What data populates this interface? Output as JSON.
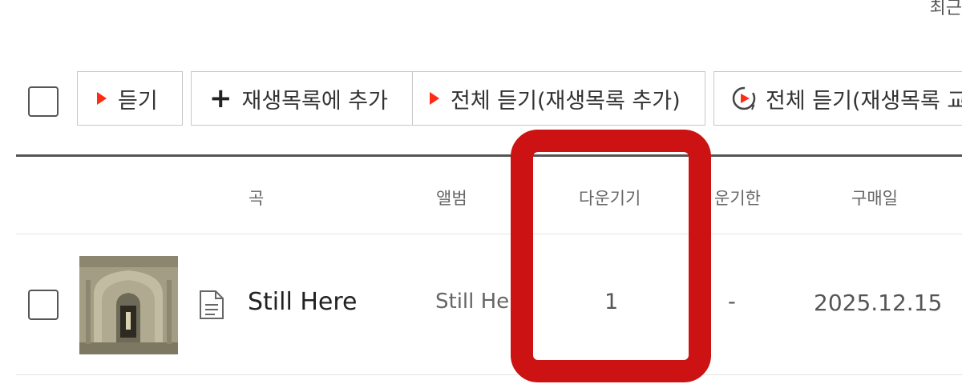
{
  "header": {
    "top_right_text": "최근"
  },
  "toolbar": {
    "listen_label": "듣기",
    "add_playlist_label": "재생목록에 추가",
    "listen_all_add_label": "전체 듣기(재생목록 추가)",
    "listen_all_replace_label": "전체 듣기(재생목록 교체)",
    "accent_color": "#ff2b14"
  },
  "table": {
    "columns": [
      "곡",
      "앨범",
      "다운기기",
      "운기한",
      "구매일"
    ],
    "rows": [
      {
        "song": "Still Here",
        "album": "Still Here",
        "download_devices": "1",
        "expiry": "-",
        "purchase_date": "2025.12.15"
      }
    ]
  },
  "annotation": {
    "highlight_color": "#cc1212"
  }
}
